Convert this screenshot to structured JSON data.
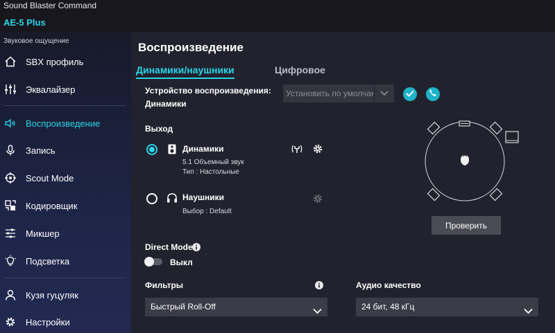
{
  "app": {
    "title": "Sound Blaster Command",
    "device": "AE-5 Plus"
  },
  "sidebar": {
    "heading": "Звуковое ощущение",
    "items": [
      {
        "label": "SBX профиль",
        "icon": "home-icon"
      },
      {
        "label": "Эквалайзер",
        "icon": "equalizer-icon"
      },
      {
        "label": "Воспроизведение",
        "icon": "speaker-icon",
        "active": true
      },
      {
        "label": "Запись",
        "icon": "microphone-icon"
      },
      {
        "label": "Scout Mode",
        "icon": "crosshair-icon"
      },
      {
        "label": "Кодировщик",
        "icon": "encoder-icon"
      },
      {
        "label": "Микшер",
        "icon": "mixer-icon"
      },
      {
        "label": "Подсветка",
        "icon": "lightbulb-icon"
      }
    ],
    "bottom": [
      {
        "label": "Кузя гуцуляк",
        "icon": "user-icon"
      },
      {
        "label": "Настройки",
        "icon": "gear-icon"
      }
    ]
  },
  "main": {
    "title": "Воспроизведение",
    "tabs": [
      {
        "label": "Динамики/наушники",
        "active": true
      },
      {
        "label": "Цифровое",
        "active": false
      }
    ],
    "device": {
      "label": "Устройство воспроизведения:",
      "value": "Динамики",
      "select_value": "Установить по умолчан"
    },
    "output": {
      "heading": "Выход",
      "speakers": {
        "name": "Динамики",
        "line1": "5.1 Объемный звук",
        "line2": "Тип : Настольные",
        "selected": true
      },
      "headphones": {
        "name": "Наушники",
        "line1": "Выбор : Default",
        "selected": false
      }
    },
    "test_button": "Проверить",
    "direct_mode": {
      "label": "Direct Mode",
      "state": "Выкл"
    },
    "filters": {
      "label": "Фильтры",
      "value": "Быстрый Roll-Off"
    },
    "audio_quality": {
      "label": "Аудио качество",
      "value": "24 бит, 48 кГц"
    }
  },
  "colors": {
    "accent": "#2bd5e8",
    "button_teal": "#1fb3c9",
    "background": "#21222e"
  }
}
